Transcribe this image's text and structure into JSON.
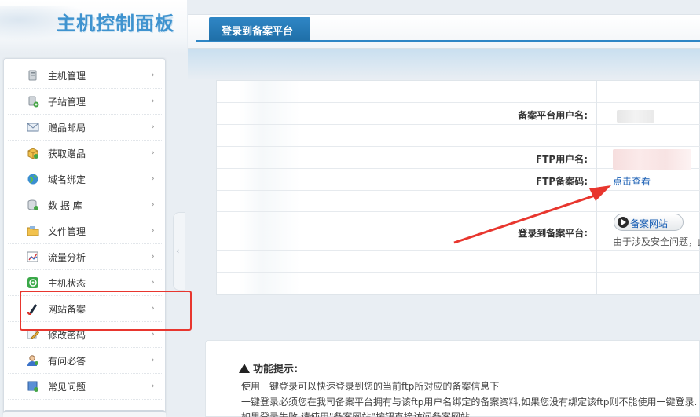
{
  "header": {
    "title": "主机控制面板"
  },
  "sidebar": {
    "items": [
      {
        "label": "主机管理",
        "icon": "server-icon"
      },
      {
        "label": "子站管理",
        "icon": "subsite-icon"
      },
      {
        "label": "赠品邮局",
        "icon": "mail-icon"
      },
      {
        "label": "获取赠品",
        "icon": "gift-box-icon"
      },
      {
        "label": "域名绑定",
        "icon": "globe-icon"
      },
      {
        "label": "数 据 库",
        "icon": "database-icon"
      },
      {
        "label": "文件管理",
        "icon": "folder-icon"
      },
      {
        "label": "流量分析",
        "icon": "chart-icon"
      },
      {
        "label": "主机状态",
        "icon": "status-icon"
      },
      {
        "label": "网站备案",
        "icon": "record-icon"
      },
      {
        "label": "修改密码",
        "icon": "pencil-icon"
      },
      {
        "label": "有问必答",
        "icon": "user-help-icon"
      },
      {
        "label": "常见问题",
        "icon": "faq-icon"
      }
    ],
    "chevron": "›",
    "collapse": "‹"
  },
  "tabs": {
    "active": "登录到备案平台"
  },
  "form": {
    "platform_user_label": "备案平台用户名:",
    "ftp_user_label": "FTP用户名:",
    "ftp_password_label": "FTP备案码:",
    "ftp_password_link": "点击查看",
    "login_label": "登录到备案平台:",
    "site_button": "备案网站",
    "security_note": "由于涉及安全问题，此"
  },
  "tips": {
    "title": "功能提示:",
    "lines": [
      "使用一键登录可以快速登录到您的当前ftp所对应的备案信息下",
      "一键登录必须您在我司备案平台拥有与该ftp用户名绑定的备案资料,如果您没有绑定该ftp则不能使用一键登录.",
      "如果登录失败,请使用\"备案网站\"按钮直接访问备案网站"
    ]
  },
  "colors": {
    "accent": "#2f86c5",
    "highlight": "#e8362e",
    "link": "#1a5fb4"
  }
}
